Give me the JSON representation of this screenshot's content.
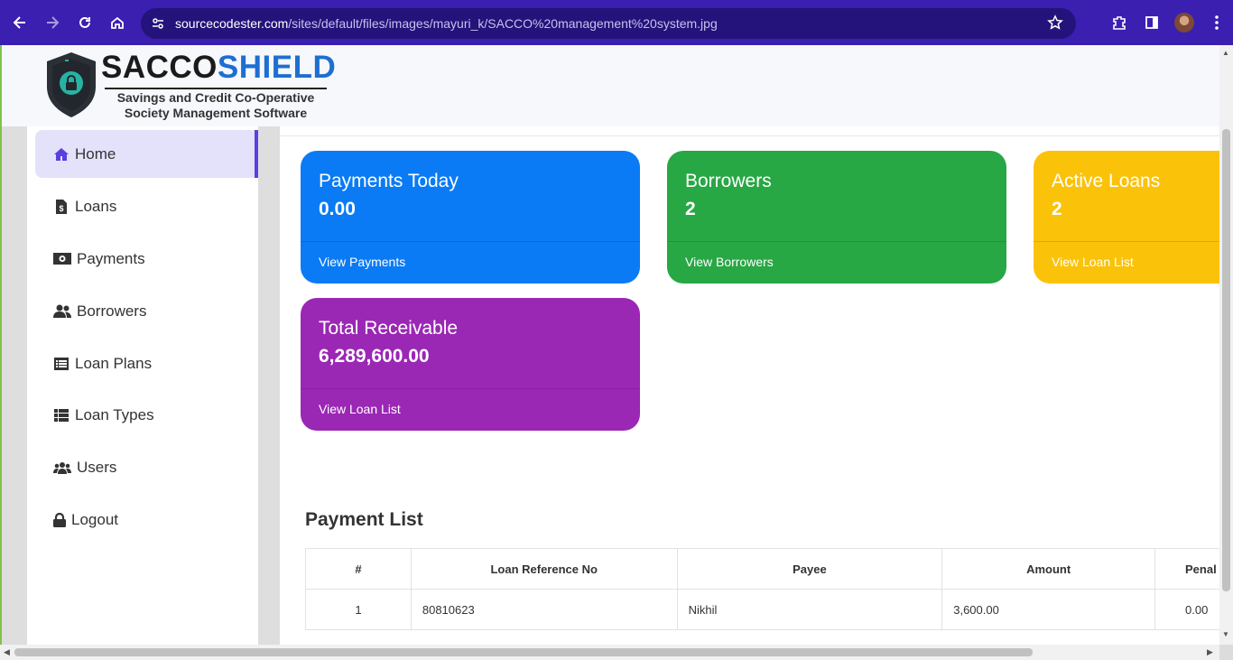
{
  "browser": {
    "url_host": "sourcecodester.com",
    "url_path": "/sites/default/files/images/mayuri_k/SACCO%20management%20system.jpg"
  },
  "logo": {
    "title_a": "SACCO",
    "title_b": "SHIELD",
    "subtitle_1": "Savings and Credit Co-Operative",
    "subtitle_2": "Society Management Software"
  },
  "sidebar": {
    "items": [
      {
        "label": "Home",
        "icon": "home-icon"
      },
      {
        "label": "Loans",
        "icon": "file-invoice-dollar-icon"
      },
      {
        "label": "Payments",
        "icon": "money-bill-icon"
      },
      {
        "label": "Borrowers",
        "icon": "user-friends-icon"
      },
      {
        "label": "Loan Plans",
        "icon": "list-alt-icon"
      },
      {
        "label": "Loan Types",
        "icon": "th-list-icon"
      },
      {
        "label": "Users",
        "icon": "users-icon"
      },
      {
        "label": "Logout",
        "icon": "lock-icon"
      }
    ]
  },
  "cards": [
    {
      "title": "Payments Today",
      "value": "0.00",
      "link": "View Payments",
      "color": "#0a7bf5"
    },
    {
      "title": "Borrowers",
      "value": "2",
      "link": "View Borrowers",
      "color": "#28a745"
    },
    {
      "title": "Active Loans",
      "value": "2",
      "link": "View Loan List",
      "color": "#fbc20a"
    },
    {
      "title": "Total Receivable",
      "value": "6,289,600.00",
      "link": "View Loan List",
      "color": "#9b27b5"
    }
  ],
  "payment_list": {
    "title": "Payment List",
    "columns": [
      "#",
      "Loan Reference No",
      "Payee",
      "Amount",
      "Penal"
    ],
    "rows": [
      [
        "1",
        "80810623",
        "Nikhil",
        "3,600.00",
        "0.00"
      ]
    ]
  },
  "colors": {
    "accent": "#5b3fe0",
    "browser_bar": "#3a1fb0"
  }
}
